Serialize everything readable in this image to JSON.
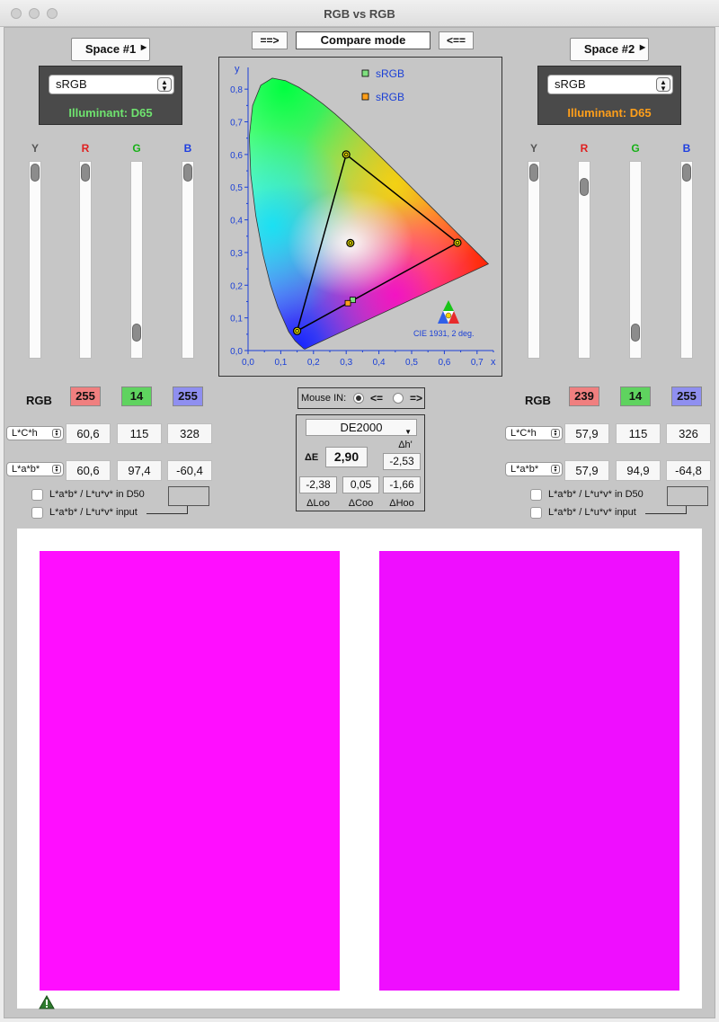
{
  "window": {
    "title": "RGB vs RGB"
  },
  "toolbar": {
    "left_arrow_label": "==>",
    "mode_label": "Compare mode",
    "right_arrow_label": "<=="
  },
  "left": {
    "space_button": "Space #1",
    "profile": "sRGB",
    "illuminant": "Illuminant: D65",
    "illuminant_color": "#6fe36f",
    "channels": [
      "Y",
      "R",
      "G",
      "B"
    ],
    "rgb_label": "RGB",
    "rgb": [
      "255",
      "14",
      "255"
    ],
    "lch_selector": "L*C*h",
    "lch": [
      "60,6",
      "115",
      "328"
    ],
    "lab_selector": "L*a*b*",
    "lab": [
      "60,6",
      "97,4",
      "-60,4"
    ],
    "check_d50": "L*a*b* / L*u*v* in D50",
    "check_input": "L*a*b* / L*u*v* input",
    "slider_levels": [
      0.0,
      0.0,
      0.92,
      0.0
    ]
  },
  "right": {
    "space_button": "Space #2",
    "profile": "sRGB",
    "illuminant": "Illuminant: D65",
    "illuminant_color": "#ff9f1a",
    "channels": [
      "Y",
      "R",
      "G",
      "B"
    ],
    "rgb_label": "RGB",
    "rgb": [
      "239",
      "14",
      "255"
    ],
    "lch_selector": "L*C*h",
    "lch": [
      "57,9",
      "115",
      "326"
    ],
    "lab_selector": "L*a*b*",
    "lab": [
      "57,9",
      "94,9",
      "-64,8"
    ],
    "check_d50": "L*a*b* / L*u*v* in D50",
    "check_input": "L*a*b* / L*u*v* input",
    "slider_levels": [
      0.0,
      0.08,
      0.92,
      0.0
    ]
  },
  "chip_colors": {
    "r": "#f07f7f",
    "g": "#5fd35f",
    "b": "#8f8ff0"
  },
  "chart_data": {
    "type": "scatter",
    "title": "",
    "annotation": "CIE 1931, 2 deg.",
    "xlabel": "x",
    "ylabel": "y",
    "xlim": [
      0,
      0.75
    ],
    "ylim": [
      0,
      0.85
    ],
    "xticks": [
      "0,0",
      "0,1",
      "0,2",
      "0,3",
      "0,4",
      "0,5",
      "0,6",
      "0,7"
    ],
    "yticks": [
      "0,0",
      "0,1",
      "0,2",
      "0,3",
      "0,4",
      "0,5",
      "0,6",
      "0,7",
      "0,8"
    ],
    "legend": [
      {
        "name": "sRGB",
        "color": "#7fe07f"
      },
      {
        "name": "sRGB",
        "color": "#ff9f1a"
      }
    ],
    "gamut_primaries": [
      [
        0.64,
        0.33
      ],
      [
        0.3,
        0.6
      ],
      [
        0.15,
        0.06
      ]
    ],
    "white_point": [
      0.3127,
      0.329
    ],
    "sample_points": [
      {
        "x": 0.32,
        "y": 0.155,
        "color": "#7fe07f"
      },
      {
        "x": 0.305,
        "y": 0.145,
        "color": "#ff9f1a"
      }
    ]
  },
  "mouse": {
    "label": "Mouse IN:",
    "left_option": "<=",
    "right_option": "=>",
    "selected": "left"
  },
  "delta": {
    "metric": "DE2000",
    "de_label": "ΔE",
    "de_value": "2,90",
    "dh_label": "Δh'",
    "dh_value": "-2,53",
    "values": [
      "-2,38",
      "0,05",
      "-1,66"
    ],
    "labels": [
      "ΔLoo",
      "ΔCoo",
      "ΔHoo"
    ]
  },
  "preview": {
    "left_color": "#ff0eff",
    "right_color": "#ef0eff"
  }
}
